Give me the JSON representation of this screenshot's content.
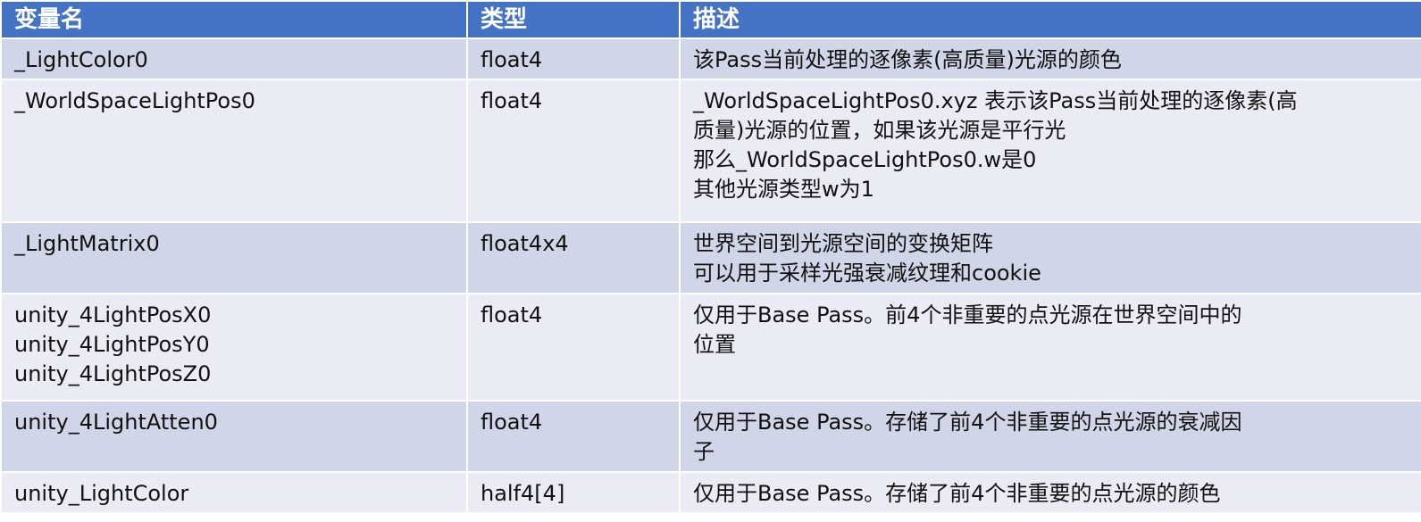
{
  "table": {
    "headers": [
      "变量名",
      "类型",
      "描述"
    ],
    "rows": [
      {
        "name": [
          "_LightColor0"
        ],
        "type": "float4",
        "desc": [
          "该Pass当前处理的逐像素(高质量)光源的颜色"
        ]
      },
      {
        "name": [
          "_WorldSpaceLightPos0"
        ],
        "type": "float4",
        "desc": [
          "_WorldSpaceLightPos0.xyz 表示该Pass当前处理的逐像素(高",
          "质量)光源的位置，如果该光源是平行光",
          "那么_WorldSpaceLightPos0.w是0",
          "其他光源类型w为1"
        ]
      },
      {
        "name": [
          "_LightMatrix0"
        ],
        "type": "float4x4",
        "desc": [
          "世界空间到光源空间的变换矩阵",
          "可以用于采样光强衰减纹理和cookie"
        ]
      },
      {
        "name": [
          "unity_4LightPosX0",
          "unity_4LightPosY0",
          "unity_4LightPosZ0"
        ],
        "type": "float4",
        "desc": [
          "仅用于Base Pass。前4个非重要的点光源在世界空间中的",
          "位置"
        ]
      },
      {
        "name": [
          "unity_4LightAtten0"
        ],
        "type": "float4",
        "desc": [
          "仅用于Base Pass。存储了前4个非重要的点光源的衰减因",
          "子"
        ]
      },
      {
        "name": [
          "unity_LightColor"
        ],
        "type": "half4[4]",
        "desc": [
          "仅用于Base Pass。存储了前4个非重要的点光源的颜色"
        ]
      }
    ]
  },
  "colors": {
    "header_bg": "#4472c4",
    "row_odd_bg": "#d0d5e8",
    "row_even_bg": "#e9ebf5"
  }
}
